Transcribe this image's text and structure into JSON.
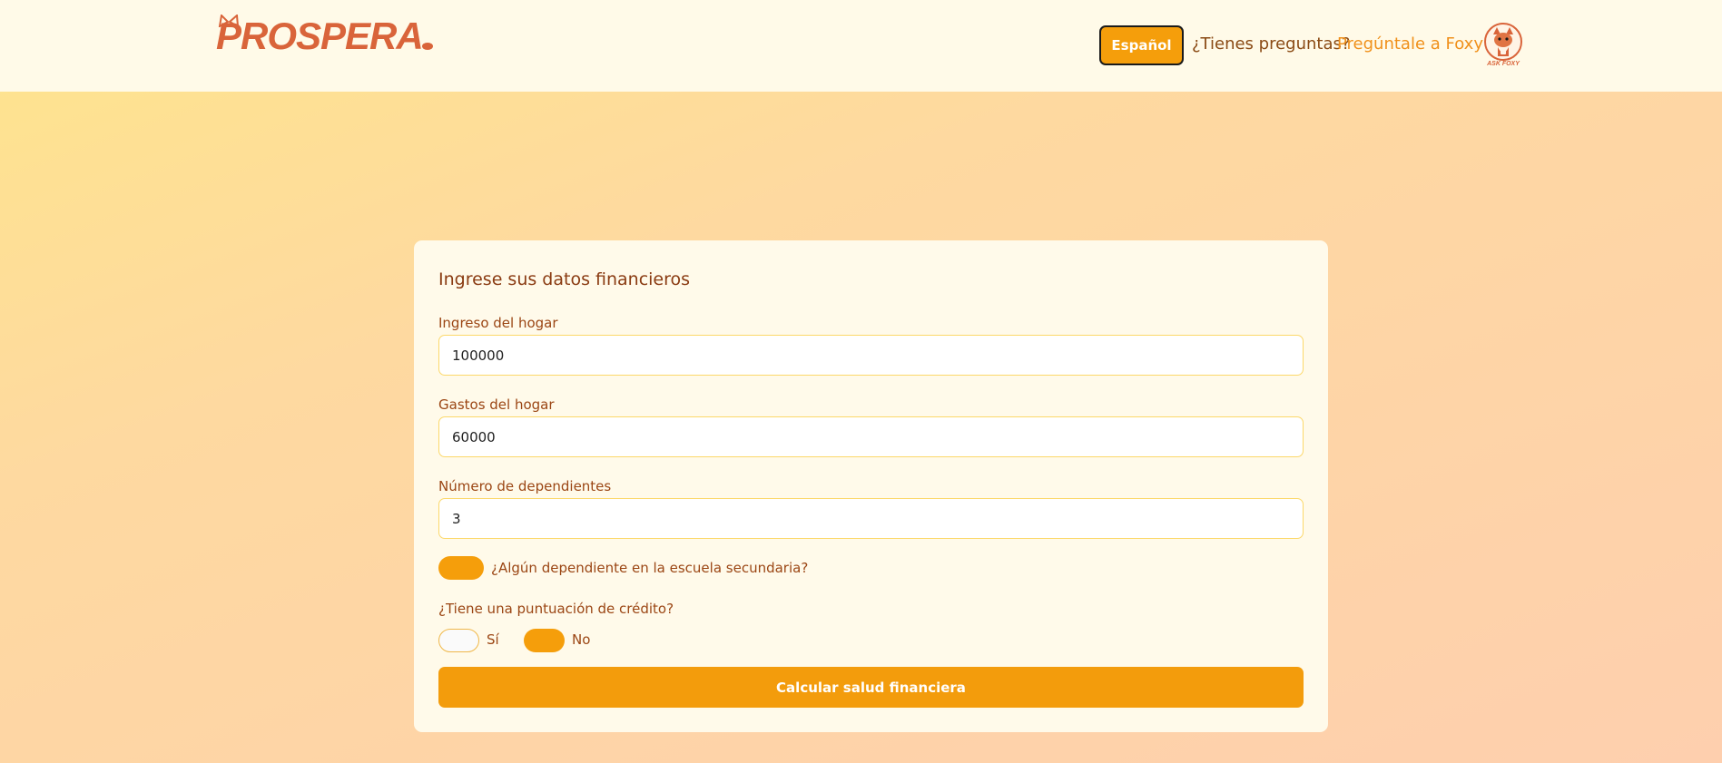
{
  "header": {
    "logo_text": "PROSPERA",
    "language_button": "Español",
    "questions_text": "¿Tienes preguntas?",
    "ask_link": "Pregúntale a Foxy!",
    "foxy_badge": "ASK FOXY"
  },
  "form": {
    "title": "Ingrese sus datos financieros",
    "income": {
      "label": "Ingreso del hogar",
      "value": "100000"
    },
    "expenses": {
      "label": "Gastos del hogar",
      "value": "60000"
    },
    "dependents": {
      "label": "Número de dependientes",
      "value": "3"
    },
    "secondary_school": {
      "label": "¿Algún dependiente en la escuela secundaria?",
      "checked": true
    },
    "credit_score": {
      "question": "¿Tiene una puntuación de crédito?",
      "options": [
        "Sí",
        "No"
      ],
      "selected": "No"
    },
    "submit_label": "Calcular salud financiera"
  },
  "colors": {
    "accent": "#f59e0b",
    "brand": "#d9643a",
    "label_text": "#9b4614",
    "header_bg": "#fffae8",
    "card_bg": "#fffaea"
  }
}
